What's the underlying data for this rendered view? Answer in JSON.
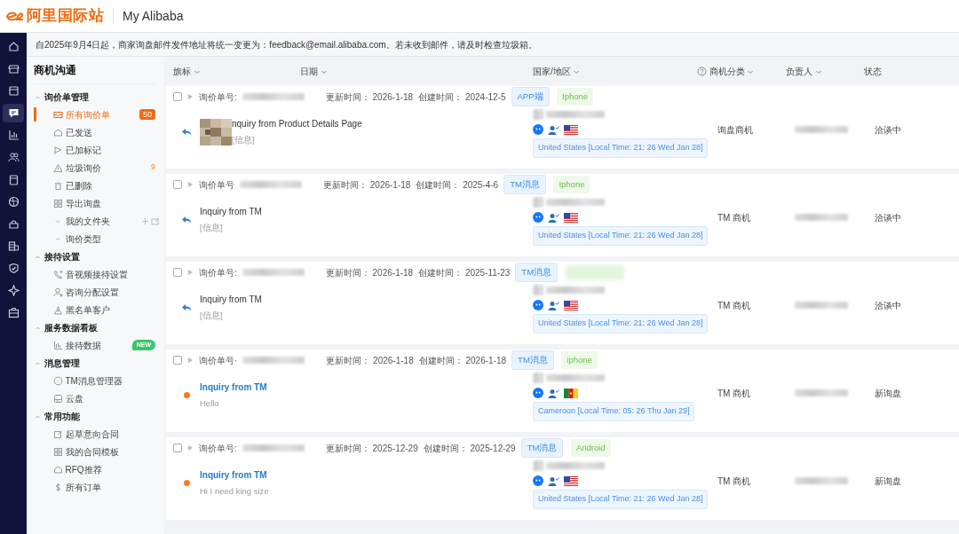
{
  "header": {
    "logo_text": "阿里国际站",
    "title": "My Alibaba"
  },
  "nav": [
    {
      "selected": false
    },
    {
      "selected": false
    },
    {
      "selected": false
    },
    {
      "selected": true
    },
    {
      "selected": false
    },
    {
      "selected": false
    },
    {
      "selected": false
    },
    {
      "selected": false
    },
    {
      "selected": false
    },
    {
      "selected": false
    },
    {
      "selected": false
    },
    {
      "selected": false
    },
    {
      "selected": false
    }
  ],
  "notice": "自2025年9月4日起，商家询盘邮件发件地址将统一变更为：feedback@email.alibaba.com。若未收到邮件，请及时检查垃圾箱。",
  "sidebar": {
    "title": "商机沟通",
    "groups": [
      {
        "label": "询价单管理",
        "expanded": true,
        "items": [
          {
            "label": "所有询价单",
            "selected": true,
            "badge": {
              "text": "50",
              "kind": "count"
            }
          },
          {
            "label": "已发送",
            "selected": false
          },
          {
            "label": "已加标记",
            "selected": false
          },
          {
            "label": "垃圾询价",
            "selected": false,
            "badge": {
              "text": "9",
              "kind": "plain"
            }
          },
          {
            "label": "已删除",
            "selected": false
          },
          {
            "label": "导出询盘",
            "selected": false
          },
          {
            "label": "我的文件夹",
            "selected": false,
            "kind": "folder",
            "expanded": false,
            "actions": true
          },
          {
            "label": "询价类型",
            "selected": false,
            "kind": "folder",
            "expanded": false
          }
        ]
      },
      {
        "label": "接待设置",
        "expanded": true,
        "items": [
          {
            "label": "音视频接待设置",
            "selected": false
          },
          {
            "label": "咨询分配设置",
            "selected": false
          },
          {
            "label": "黑名单客户",
            "selected": false
          }
        ]
      },
      {
        "label": "服务数据看板",
        "expanded": true,
        "items": [
          {
            "label": "接待数据",
            "selected": false,
            "badge": {
              "text": "NEW",
              "kind": "new"
            }
          }
        ]
      },
      {
        "label": "消息管理",
        "expanded": true,
        "items": [
          {
            "label": "TM消息管理器",
            "selected": false
          },
          {
            "label": "云盘",
            "selected": false
          }
        ]
      },
      {
        "label": "常用功能",
        "expanded": true,
        "items": [
          {
            "label": "起草意向合同",
            "selected": false
          },
          {
            "label": "我的合同模板",
            "selected": false
          },
          {
            "label": "RFQ推荐",
            "selected": false
          },
          {
            "label": "所有订单",
            "selected": false
          }
        ]
      }
    ]
  },
  "columns": [
    {
      "label": "旗标",
      "dropdown": true
    },
    {
      "label": "日期",
      "dropdown": true
    },
    {
      "label": "国家/地区",
      "dropdown": true
    },
    {
      "label": "商机分类",
      "dropdown": true,
      "help": true
    },
    {
      "label": "负责人",
      "dropdown": true
    },
    {
      "label": "状态"
    }
  ],
  "rows": [
    {
      "checked": false,
      "order_label": "询价单号:",
      "updated": "更新时间： 2026-1-18",
      "created": "创建时间： 2024-12-5",
      "tags": [
        {
          "text": "APP端",
          "kind": "source"
        },
        {
          "text": "Iphone",
          "kind": "device"
        }
      ],
      "unread": false,
      "thumbnail": true,
      "title": "nquiry from Product Details Page",
      "subtitle": "[信息]",
      "country": {
        "text": "United States [Local Time: 21: 26 Wed Jan 28]",
        "kind": "us"
      },
      "category": "询盘商机",
      "status": "洽谈中"
    },
    {
      "checked": false,
      "order_label": "询价单号",
      "updated": "更新时间： 2026-1-18",
      "created": "创建时间： 2025-4-6",
      "tags": [
        {
          "text": "TM消息",
          "kind": "source"
        },
        {
          "text": "Iphone",
          "kind": "device"
        }
      ],
      "unread": false,
      "title": "Inquiry from TM",
      "subtitle": "[信息]",
      "country": {
        "text": "United States [Local Time: 21: 26 Wed Jan 28]",
        "kind": "us"
      },
      "category": "TM 商机",
      "status": "洽谈中"
    },
    {
      "checked": false,
      "order_label": "询价单号:",
      "updated": "更新时间： 2026-1-18",
      "created": "创建时间： 2025-11-23",
      "tags": [
        {
          "text": "TM消息",
          "kind": "source"
        },
        {
          "kind": "blurred"
        }
      ],
      "unread": false,
      "title": "Inquiry from TM",
      "subtitle": "[信息]",
      "country": {
        "text": "United States [Local Time: 21: 26 Wed Jan 28]",
        "kind": "us"
      },
      "category": "TM 商机",
      "status": "洽谈中"
    },
    {
      "checked": false,
      "order_label": "询价单号·",
      "updated": "更新时间： 2026-1-18",
      "created": "创建时间： 2026-1-18",
      "tags": [
        {
          "text": "TM消息",
          "kind": "source"
        },
        {
          "text": "iphone",
          "kind": "device"
        }
      ],
      "unread": true,
      "title": "Inquiry from TM",
      "subtitle": "Hello",
      "country": {
        "text": "Cameroon [Local Time: 05: 26 Thu Jan 29]",
        "kind": "cm"
      },
      "category": "TM 商机",
      "status": "新询盘"
    },
    {
      "checked": false,
      "order_label": "询价单号:",
      "updated": "更新时间： 2025-12-29",
      "created": "创建时间： 2025-12-29",
      "tags": [
        {
          "text": "TM消息",
          "kind": "source"
        },
        {
          "text": "Android",
          "kind": "device"
        }
      ],
      "unread": true,
      "title": "Inquiry from TM",
      "subtitle": "Hi I need king size",
      "country": {
        "text": "United States [Local Time: 21: 26 Wed Jan 28]",
        "kind": "us"
      },
      "category": "TM 商机",
      "status": "新询盘"
    }
  ]
}
